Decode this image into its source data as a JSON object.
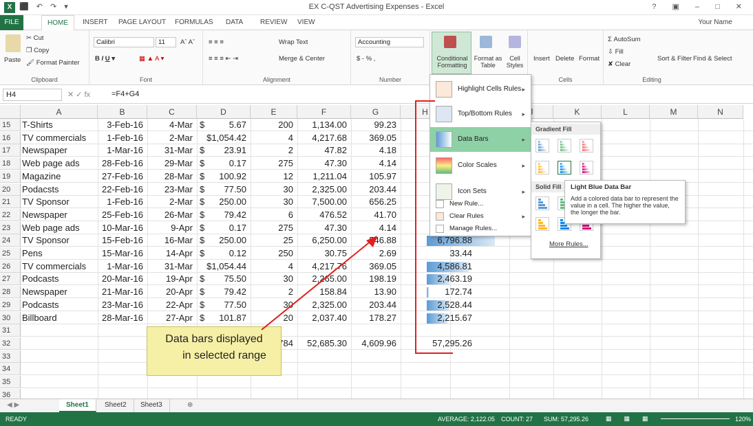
{
  "window": {
    "title": "EX C-QST Advertising Expenses - Excel",
    "app_icon": "X",
    "quick_access": "⬛ ↶ ↷ ▾",
    "controls": "? ▣ – □ ✕"
  },
  "ribbon_tabs": [
    "FILE",
    "HOME",
    "INSERT",
    "PAGE LAYOUT",
    "FORMULAS",
    "DATA",
    "REVIEW",
    "VIEW"
  ],
  "user": "Your Name",
  "ribbon": {
    "clipboard": {
      "paste": "Paste",
      "cut": "Cut",
      "copy": "Copy",
      "format_painter": "Format Painter",
      "label": "Clipboard"
    },
    "font": {
      "name": "Calibri",
      "size": "11",
      "label": "Font"
    },
    "alignment": {
      "wrap": "Wrap Text",
      "merge": "Merge & Center",
      "label": "Alignment"
    },
    "number": {
      "format": "Accounting",
      "label": "Number",
      "currency": "$ - % ,"
    },
    "styles": {
      "conditional": "Conditional Formatting",
      "format_table": "Format as Table",
      "cell_styles": "Cell Styles"
    },
    "cells": {
      "insert": "Insert",
      "delete": "Delete",
      "format": "Format",
      "label": "Cells"
    },
    "editing": {
      "autosum": "AutoSum",
      "fill": "Fill",
      "clear": "Clear",
      "sort": "Sort & Filter",
      "find": "Find & Select",
      "label": "Editing"
    }
  },
  "formula_bar": {
    "name_box": "H4",
    "formula": "=F4+G4",
    "symbols": "✕  ✓  fx"
  },
  "columns": [
    "A",
    "B",
    "C",
    "D",
    "E",
    "F",
    "G",
    "H",
    "I",
    "J",
    "K",
    "L",
    "M",
    "N"
  ],
  "rows": [
    {
      "n": "15",
      "a": "T-Shirts",
      "b": "3-Feb-16",
      "c": "4-Mar",
      "d": "5.67",
      "e": "200",
      "f": "1,134.00",
      "g": "99.23",
      "h": "",
      "bar": 0
    },
    {
      "n": "16",
      "a": "TV commercials",
      "b": "1-Feb-16",
      "c": "2-Mar",
      "d": "$1,054.42",
      "e": "4",
      "f": "4,217.68",
      "g": "369.05",
      "h": "",
      "bar": 0
    },
    {
      "n": "17",
      "a": "Newspaper",
      "b": "1-Mar-16",
      "c": "31-Mar",
      "d": "23.91",
      "e": "2",
      "f": "47.82",
      "g": "4.18",
      "h": "",
      "bar": 0
    },
    {
      "n": "18",
      "a": "Web page ads",
      "b": "28-Feb-16",
      "c": "29-Mar",
      "d": "0.17",
      "e": "275",
      "f": "47.30",
      "g": "4.14",
      "h": "",
      "bar": 0
    },
    {
      "n": "19",
      "a": "Magazine",
      "b": "27-Feb-16",
      "c": "28-Mar",
      "d": "100.92",
      "e": "12",
      "f": "1,211.04",
      "g": "105.97",
      "h": "",
      "bar": 0
    },
    {
      "n": "20",
      "a": "Podacsts",
      "b": "22-Feb-16",
      "c": "23-Mar",
      "d": "77.50",
      "e": "30",
      "f": "2,325.00",
      "g": "203.44",
      "h": "",
      "bar": 0
    },
    {
      "n": "21",
      "a": "TV Sponsor",
      "b": "1-Feb-16",
      "c": "2-Mar",
      "d": "250.00",
      "e": "30",
      "f": "7,500.00",
      "g": "656.25",
      "h": "",
      "bar": 0
    },
    {
      "n": "22",
      "a": "Newspaper",
      "b": "25-Feb-16",
      "c": "26-Mar",
      "d": "79.42",
      "e": "6",
      "f": "476.52",
      "g": "41.70",
      "h": "",
      "bar": 0
    },
    {
      "n": "23",
      "a": "Web page ads",
      "b": "10-Mar-16",
      "c": "9-Apr",
      "d": "0.17",
      "e": "275",
      "f": "47.30",
      "g": "4.14",
      "h": "",
      "bar": 0
    },
    {
      "n": "24",
      "a": "TV Sponsor",
      "b": "15-Feb-16",
      "c": "16-Mar",
      "d": "250.00",
      "e": "25",
      "f": "6,250.00",
      "g": "546.88",
      "h": "6,796.88",
      "bar": 0.9
    },
    {
      "n": "25",
      "a": "Pens",
      "b": "15-Mar-16",
      "c": "14-Apr",
      "d": "0.12",
      "e": "250",
      "f": "30.75",
      "g": "2.69",
      "h": "33.44",
      "bar": 0
    },
    {
      "n": "26",
      "a": "TV commercials",
      "b": "1-Mar-16",
      "c": "31-Mar",
      "d": "$1,054.44",
      "e": "4",
      "f": "4,217.76",
      "g": "369.05",
      "h": "4,586.81",
      "bar": 0.55
    },
    {
      "n": "27",
      "a": "Podcasts",
      "b": "20-Mar-16",
      "c": "19-Apr",
      "d": "75.50",
      "e": "30",
      "f": "2,265.00",
      "g": "198.19",
      "h": "2,463.19",
      "bar": 0.3
    },
    {
      "n": "28",
      "a": "Newspaper",
      "b": "21-Mar-16",
      "c": "20-Apr",
      "d": "79.42",
      "e": "2",
      "f": "158.84",
      "g": "13.90",
      "h": "172.74",
      "bar": 0.03
    },
    {
      "n": "29",
      "a": "Podcasts",
      "b": "23-Mar-16",
      "c": "22-Apr",
      "d": "77.50",
      "e": "30",
      "f": "2,325.00",
      "g": "203.44",
      "h": "2,528.44",
      "bar": 0.3
    },
    {
      "n": "30",
      "a": "Billboard",
      "b": "28-Mar-16",
      "c": "27-Apr",
      "d": "101.87",
      "e": "20",
      "f": "2,037.40",
      "g": "178.27",
      "h": "2,215.67",
      "bar": 0.27
    },
    {
      "n": "31",
      "a": "",
      "b": "",
      "c": "",
      "d": "",
      "e": "",
      "f": "",
      "g": "",
      "h": "",
      "bar": 0
    },
    {
      "n": "32",
      "a": "",
      "b": "",
      "c": "",
      "d": "",
      "e": "1784",
      "f": "52,685.30",
      "g": "4,609.96",
      "h": "57,295.26",
      "bar": 0
    },
    {
      "n": "33",
      "a": "",
      "b": "",
      "c": "",
      "d": "",
      "e": "",
      "f": "",
      "g": "",
      "h": "",
      "bar": 0
    },
    {
      "n": "34",
      "a": "",
      "b": "",
      "c": "",
      "d": "",
      "e": "",
      "f": "",
      "g": "",
      "h": "",
      "bar": 0
    },
    {
      "n": "35",
      "a": "",
      "b": "",
      "c": "",
      "d": "",
      "e": "",
      "f": "",
      "g": "",
      "h": "",
      "bar": 0
    },
    {
      "n": "36",
      "a": "",
      "b": "",
      "c": "",
      "d": "",
      "e": "",
      "f": "",
      "g": "",
      "h": "",
      "bar": 0
    }
  ],
  "menu": {
    "highlight": "Highlight Cells Rules",
    "topbottom": "Top/Bottom Rules",
    "databars": "Data Bars",
    "colorscales": "Color Scales",
    "iconsets": "Icon Sets",
    "newrule": "New Rule...",
    "clearrules": "Clear Rules",
    "managerules": "Manage Rules..."
  },
  "submenu": {
    "gradient": "Gradient Fill",
    "solid": "Solid Fill",
    "more": "More Rules..."
  },
  "tooltip": {
    "title": "Light Blue Data Bar",
    "body": "Add a colored data bar to represent the value in a cell. The higher the value, the longer the bar."
  },
  "callout": {
    "line1": "Data bars displayed",
    "line2": "in selected range"
  },
  "sheets": [
    "Sheet1",
    "Sheet2",
    "Sheet3"
  ],
  "status": {
    "ready": "READY",
    "average": "AVERAGE: 2,122.05",
    "count": "COUNT: 27",
    "sum": "SUM: 57,295.26",
    "zoom": "120%"
  },
  "colors": {
    "excel_green": "#217346",
    "menu_highlight": "#8fd1a6",
    "callout": "#f6f0a6",
    "arrow": "#e02020",
    "bar": "#5b9bd5"
  }
}
